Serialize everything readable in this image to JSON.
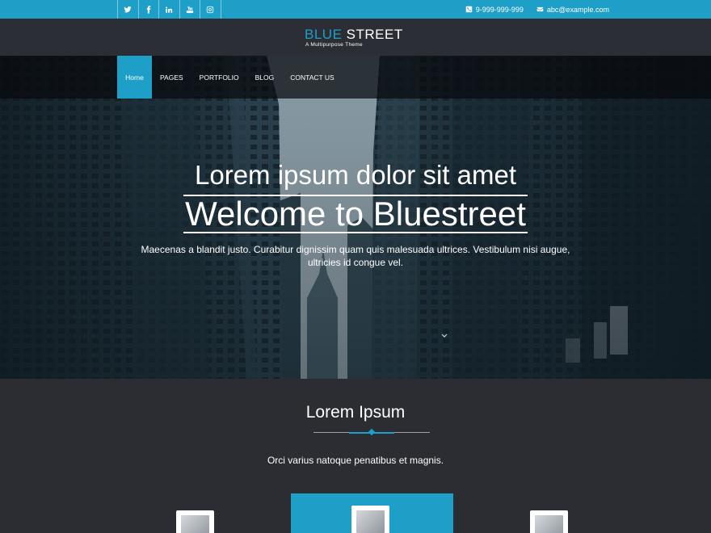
{
  "topbar": {
    "social": [
      {
        "icon": "twitter-icon",
        "glyph": "twitter"
      },
      {
        "icon": "facebook-icon",
        "glyph": "f"
      },
      {
        "icon": "linkedin-icon",
        "glyph": "in"
      },
      {
        "icon": "youtube-icon",
        "glyph": "youtube"
      },
      {
        "icon": "instagram-icon",
        "glyph": "instagram"
      }
    ],
    "phone": "9-999-999-999",
    "email": "abc@example.com"
  },
  "logo": {
    "part1": "BLUE",
    "part2": "STREET",
    "tagline": "A Multipurpose Theme"
  },
  "nav": {
    "items": [
      "Home",
      "PAGES",
      "PORTFOLIO",
      "BLOG",
      "CONTACT US"
    ],
    "active": "Home"
  },
  "hero": {
    "subtitle": "Lorem ipsum dolor sit amet",
    "title": "Welcome to Bluestreet",
    "description": "Maecenas a blandit justo. Curabitur dignissim quam quis malesuada ultrices. Vestibulum nisi augue, ultricies id congue vel."
  },
  "section": {
    "title": "Lorem Ipsum",
    "description": "Orci varius natoque penatibus et magnis."
  },
  "colors": {
    "accent": "#1e9fc7",
    "dark": "#2b2d33"
  }
}
